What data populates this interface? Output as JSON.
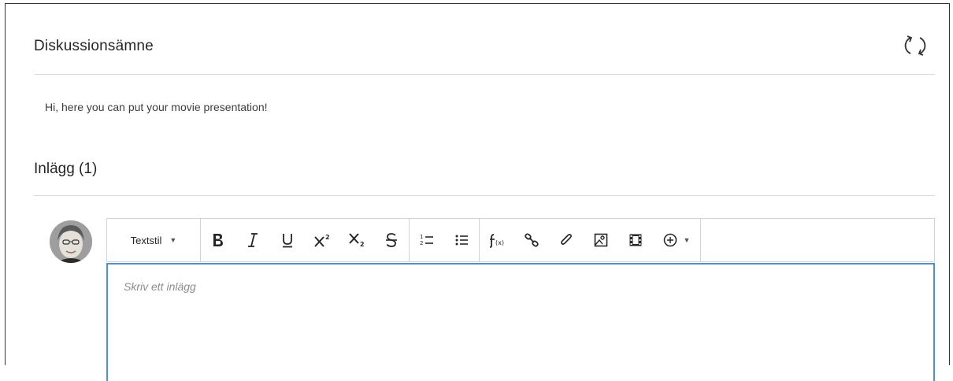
{
  "topic": {
    "title": "Diskussionsämne",
    "description": "Hi, here you can put your movie presentation!"
  },
  "posts": {
    "heading": "Inlägg (1)"
  },
  "editor": {
    "text_style_label": "Textstil",
    "placeholder": "Skriv ett inlägg",
    "toolbar_icons": [
      "bold-icon",
      "italic-icon",
      "underline-icon",
      "superscript-icon",
      "subscript-icon",
      "strikethrough-icon",
      "ordered-list-icon",
      "unordered-list-icon",
      "math-formula-icon",
      "link-icon",
      "attachment-icon",
      "image-icon",
      "video-icon",
      "add-content-icon"
    ]
  },
  "colors": {
    "focus_border": "#4a90d9",
    "divider": "#d9d9d9",
    "text": "#262626"
  }
}
